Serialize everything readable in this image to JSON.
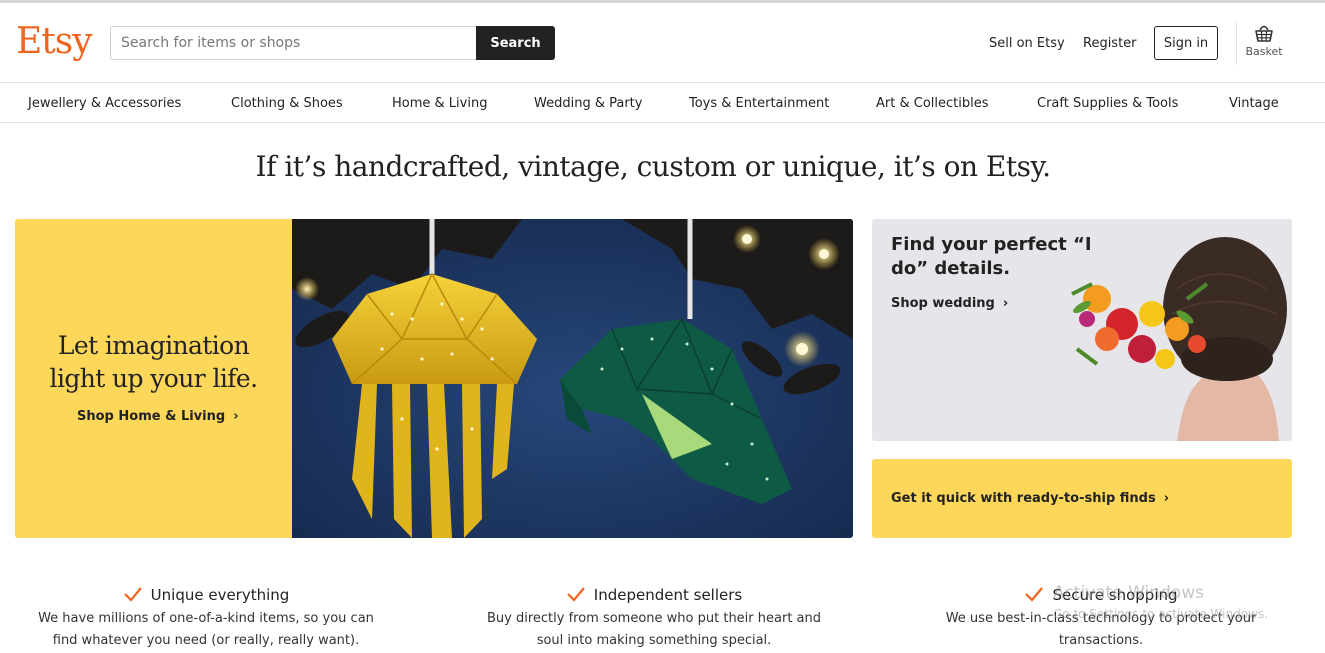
{
  "header": {
    "logo": "Etsy",
    "search_placeholder": "Search for items or shops",
    "search_button": "Search",
    "sell_link": "Sell on Etsy",
    "register_link": "Register",
    "signin_button": "Sign in",
    "basket_label": "Basket"
  },
  "categories": [
    "Jewellery & Accessories",
    "Clothing & Shoes",
    "Home & Living",
    "Wedding & Party",
    "Toys & Entertainment",
    "Art & Collectibles",
    "Craft Supplies & Tools",
    "Vintage"
  ],
  "headline": "If it’s handcrafted, vintage, custom or unique, it’s on Etsy.",
  "hero": {
    "title": "Let imagination light up your life.",
    "link": "Shop Home & Living"
  },
  "wedding": {
    "title": "Find your perfect “I do” details.",
    "link": "Shop wedding"
  },
  "ship": {
    "link": "Get it quick with ready-to-ship finds"
  },
  "chevron": "›",
  "value_props": [
    {
      "title": "Unique everything",
      "text": "We have millions of one-of-a-kind items, so you can find whatever you need (or really, really want)."
    },
    {
      "title": "Independent sellers",
      "text": "Buy directly from someone who put their heart and soul into making something special."
    },
    {
      "title": "Secure shopping",
      "text": "We use best-in-class technology to protect your transactions."
    }
  ],
  "watermark": {
    "title": "Activate Windows",
    "subtitle": "Go to Settings to activate Windows."
  },
  "colors": {
    "brand_orange": "#f1641e",
    "yellow": "#fdd75a",
    "dark": "#222222"
  }
}
